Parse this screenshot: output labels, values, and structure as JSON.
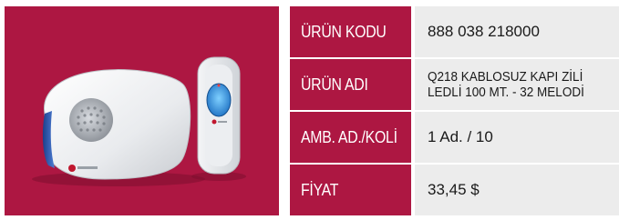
{
  "product_image": {
    "icon": "wireless-doorbell-image",
    "brand_logo_label": "brand-logo"
  },
  "spec_table": {
    "rows": [
      {
        "label": "ÜRÜN KODU",
        "value": "888 038 218000"
      },
      {
        "label": "ÜRÜN ADI",
        "value": "Q218 KABLOSUZ KAPI ZİLİ LEDLİ 100 MT. - 32 MELODİ"
      },
      {
        "label": "AMB. AD./KOLİ",
        "value": "1 Ad. / 10"
      },
      {
        "label": "FİYAT",
        "value": "33,45 $"
      }
    ]
  },
  "colors": {
    "accent": "#ad1742",
    "cell_bg": "#ececec"
  }
}
